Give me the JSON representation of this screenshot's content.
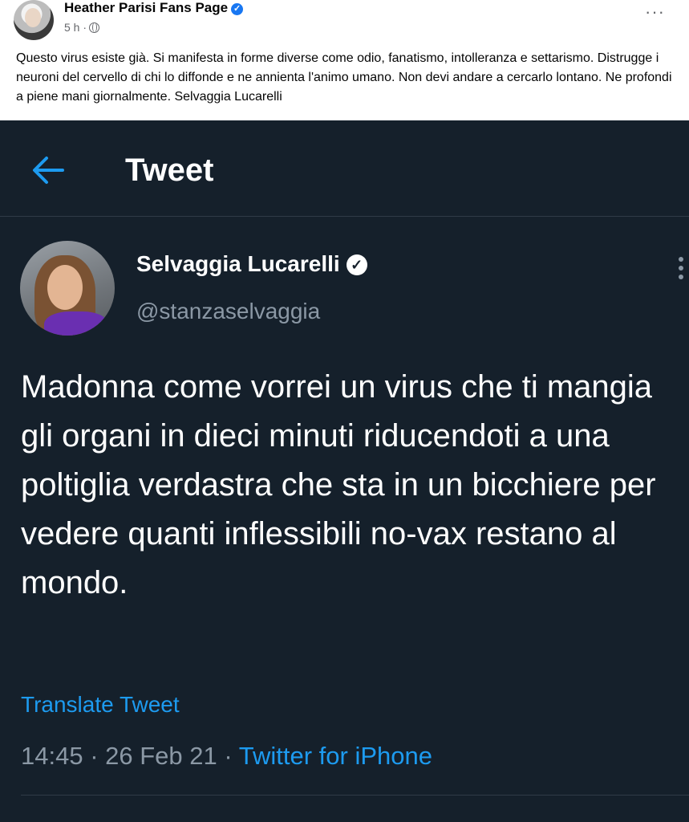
{
  "facebook_post": {
    "page_name": "Heather Parisi Fans Page",
    "time": "5 h",
    "separator": "·",
    "text": "Questo virus esiste già. Si manifesta in forme diverse come odio, fanatismo, intolleranza e settarismo. Distrugge i neuroni del cervello di chi lo diffonde e ne annienta l'animo umano. Non devi andare a cercarlo lontano. Ne profondi a piene mani giornalmente. Selvaggia Lucarelli",
    "more_label": "···"
  },
  "tweet": {
    "header_title": "Tweet",
    "author_name": "Selvaggia Lucarelli",
    "handle": "@stanzaselvaggia",
    "body": "Madonna come vorrei un virus che ti mangia gli organi in dieci minuti riducendoti a una poltiglia verdastra che sta in un bicchiere per vedere quanti inflessibili no-vax restano al mondo.",
    "translate_label": "Translate Tweet",
    "time": "14:45",
    "date": "26 Feb 21",
    "dot": "·",
    "source": "Twitter for iPhone"
  },
  "colors": {
    "twitter_bg": "#15202b",
    "twitter_blue": "#1d9bf0",
    "twitter_muted": "#8b98a5",
    "facebook_blue": "#1877f2"
  },
  "icons": [
    "profile-picture",
    "verified-badge-icon",
    "globe-icon",
    "more-options-icon",
    "back-arrow-icon",
    "more-vertical-icon"
  ]
}
